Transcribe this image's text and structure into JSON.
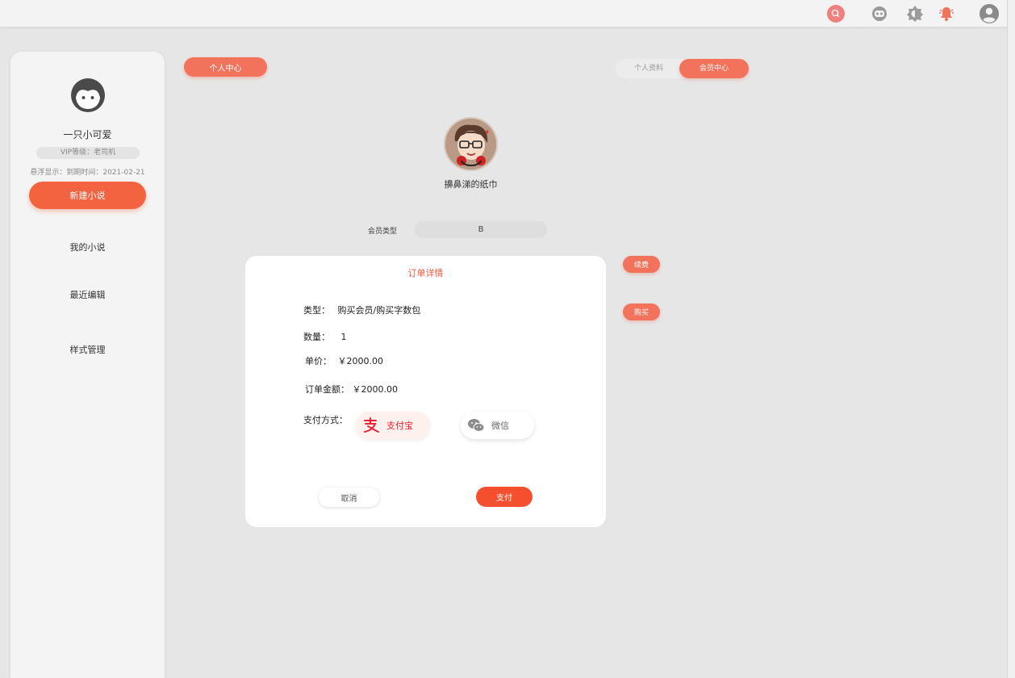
{
  "topbar": {
    "icons": [
      "search-icon",
      "robot-icon",
      "brightness-icon",
      "bell-icon",
      "user-icon"
    ],
    "accent": "#f2725b",
    "search_color": "#f08080",
    "bell_color": "#f2725b"
  },
  "sidebar": {
    "nickname": "一只小可爱",
    "vip_level": "VIP等级：老司机",
    "expire_text": "悬浮显示：到期时间：2021-02-21",
    "new_novel_label": "新建小说",
    "items": [
      {
        "label": "我的小说"
      },
      {
        "label": "最近编辑"
      },
      {
        "label": "样式管理"
      }
    ]
  },
  "main": {
    "personal_center_label": "个人中心",
    "tabs": [
      {
        "label": "个人资料",
        "active": false
      },
      {
        "label": "会员中心",
        "active": true
      }
    ],
    "profile_name": "擤鼻涕的纸巾",
    "member_type_label": "会员类型",
    "member_type_value": "B",
    "renew_label": "续费",
    "buy_label": "购买"
  },
  "order": {
    "title": "订单详情",
    "type_label": "类型：",
    "type_value": "购买会员/购买字数包",
    "qty_label": "数量：",
    "qty_value": "1",
    "price_label": "单价：",
    "price_value": "￥2000.00",
    "total_label": "订单金额：",
    "total_value": "￥2000.00",
    "pay_method_label": "支付方式：",
    "alipay_label": "支付宝",
    "wechat_label": "微信",
    "cancel_label": "取消",
    "pay_label": "支付",
    "colors": {
      "alipay": "#e23",
      "pay_button": "#f4502f",
      "title": "#f05a3c"
    }
  }
}
